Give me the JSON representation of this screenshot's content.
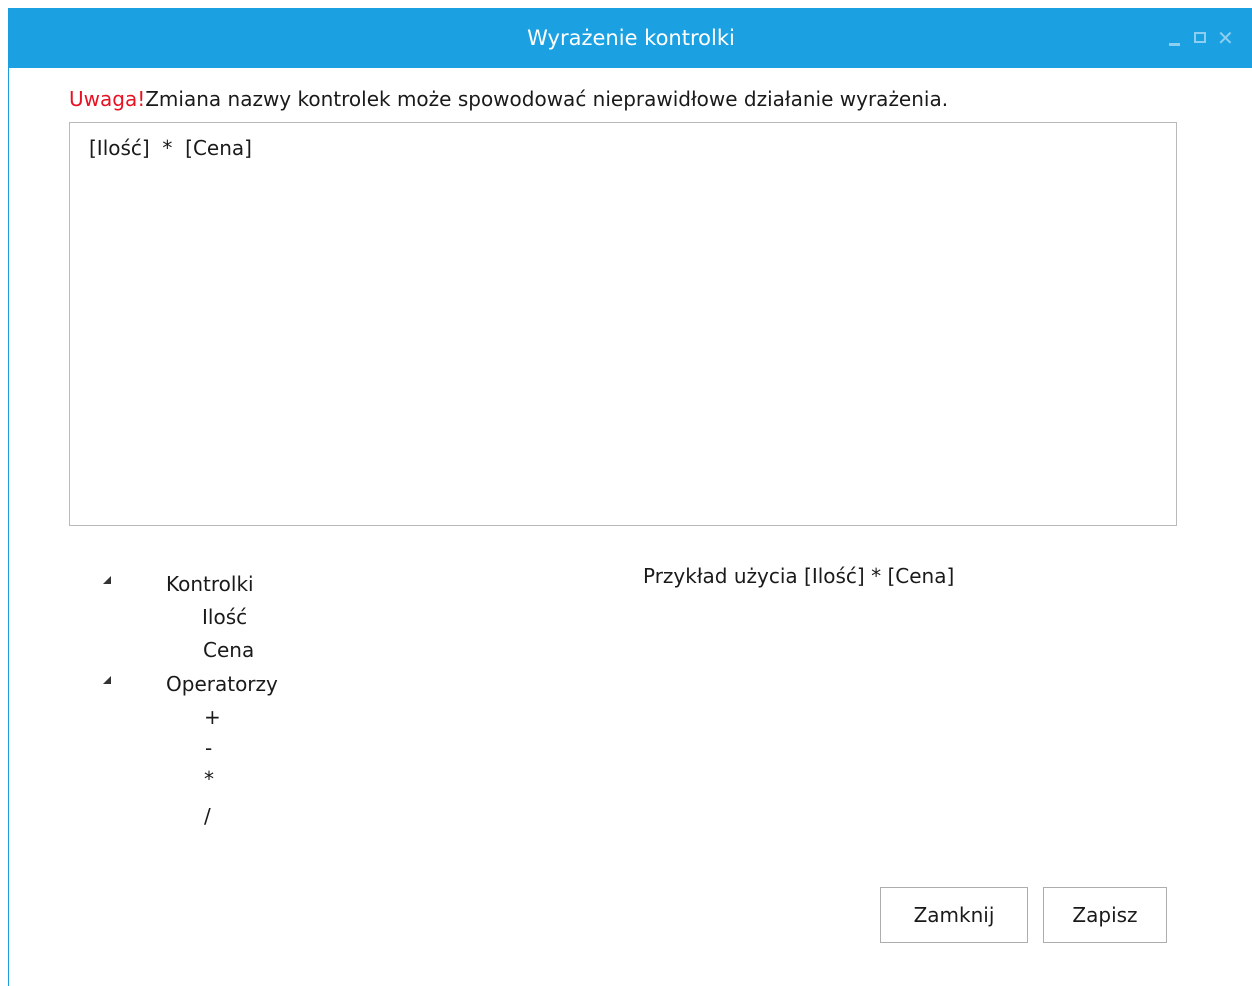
{
  "window": {
    "title": "Wyrażenie kontrolki",
    "controls": [
      "minimize-icon",
      "maximize-icon",
      "close-icon"
    ],
    "close_glyph": "✕",
    "accent": "#1ba1e2"
  },
  "warning": {
    "prefix": "Uwaga!",
    "message": "Zmiana nazwy kontrolek może spowodować nieprawidłowe działanie wyrażenia.",
    "prefix_color": "#e81123"
  },
  "editor": {
    "value": "[Ilość]  *  [Cena]"
  },
  "tree": {
    "groups": [
      {
        "label": "Kontrolki",
        "expanded": true,
        "children": [
          "Ilość",
          "Cena"
        ]
      },
      {
        "label": "Operatorzy",
        "expanded": true,
        "children": [
          "+",
          "-",
          "*",
          "/"
        ]
      }
    ]
  },
  "example": {
    "text": "Przykład użycia [Ilość] * [Cena]"
  },
  "buttons": {
    "close_label": "Zamknij",
    "save_label": "Zapisz"
  }
}
